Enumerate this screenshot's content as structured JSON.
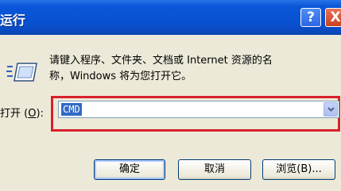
{
  "window": {
    "title": "运行",
    "help_button": "?",
    "close_button": "X"
  },
  "icon": "run-program-icon",
  "prompt": {
    "line1": "请键入程序、文件夹、文档或 Internet 资源的名",
    "line2": "称，Windows 将为您打开它。"
  },
  "open_field": {
    "label_prefix": "打开 (",
    "label_mnemonic": "O",
    "label_suffix": "):",
    "value": "CMD"
  },
  "buttons": {
    "ok": "确定",
    "cancel": "取消",
    "browse": "浏览(B)..."
  },
  "colors": {
    "titlebar": "#0852d2",
    "highlight": "#d8202a",
    "selection": "#316ac5"
  }
}
